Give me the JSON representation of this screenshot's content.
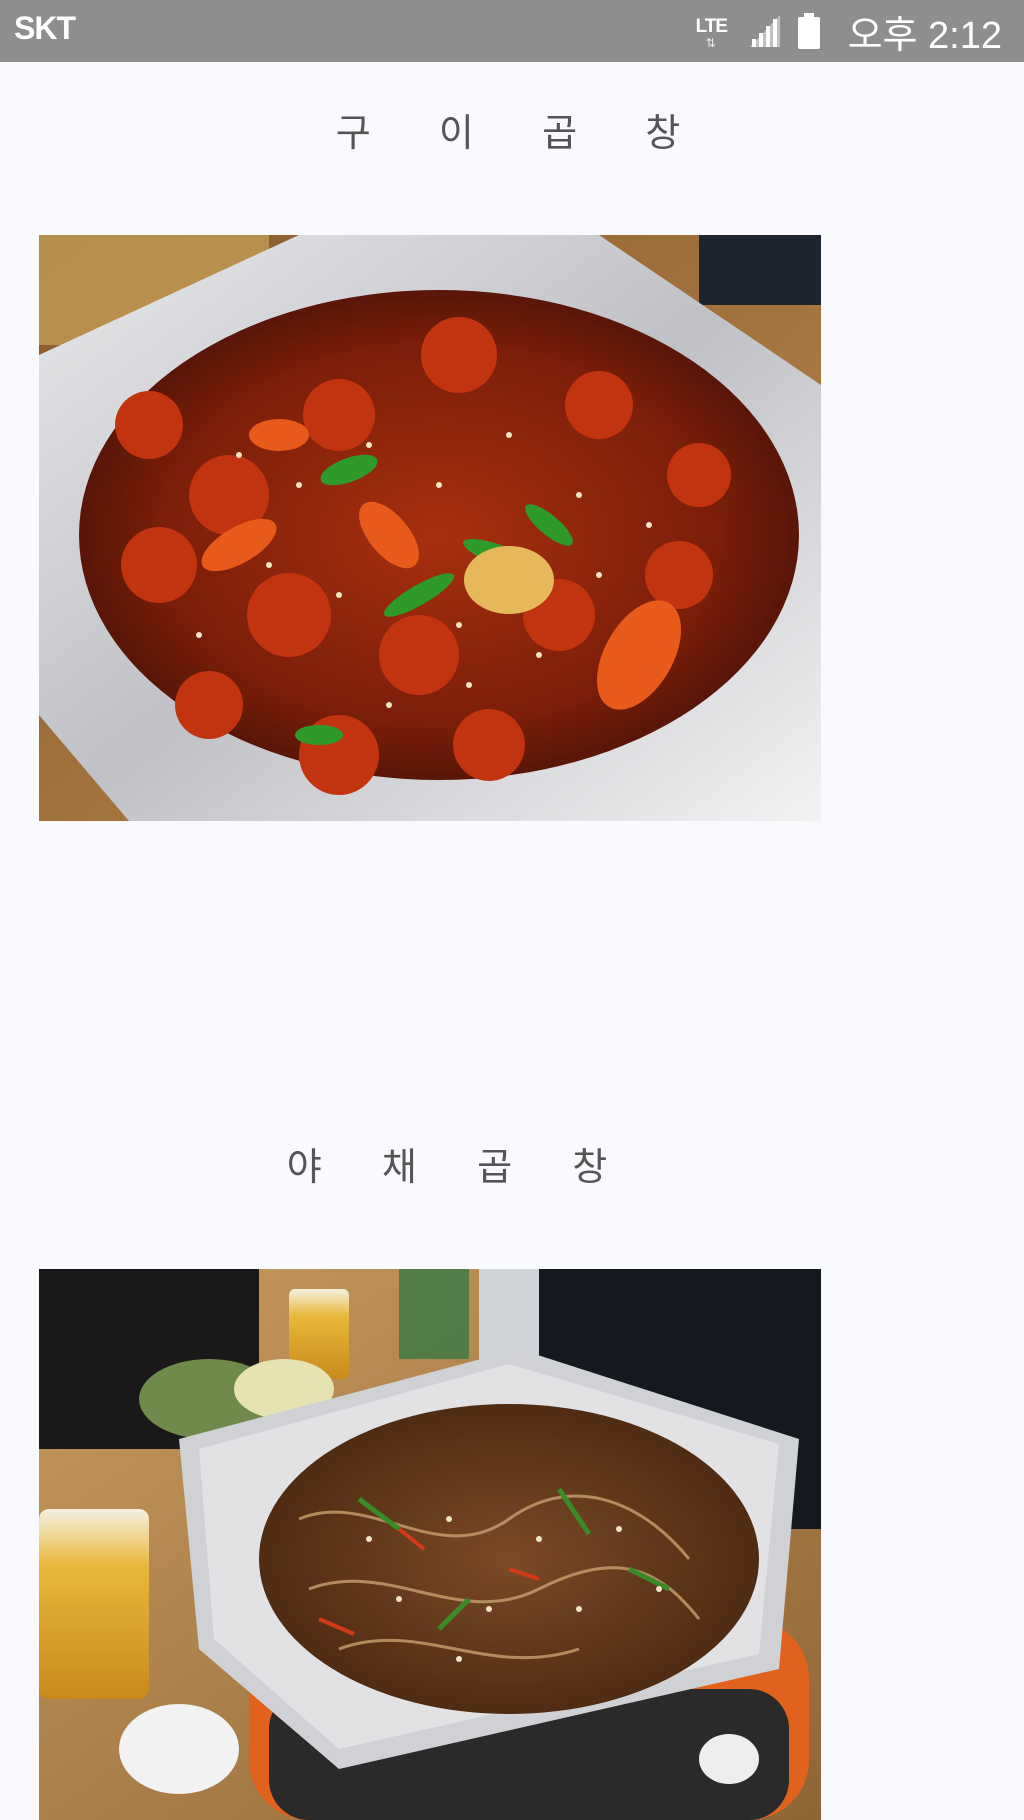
{
  "status_bar": {
    "carrier": "SKT",
    "network": "LTE",
    "network_arrows": "⇅",
    "time": "오후 2:12",
    "icons": [
      "lte-icon",
      "signal-icon",
      "battery-icon"
    ]
  },
  "sections": [
    {
      "title": "구   이   곱   창",
      "image": "grilled-gopchang-photo"
    },
    {
      "title": "야   채   곱   창",
      "image": "vegetable-gopchang-photo"
    }
  ],
  "colors": {
    "status_bar": "#8e8e8e",
    "background": "#f9fafd",
    "title_text": "#555555"
  }
}
